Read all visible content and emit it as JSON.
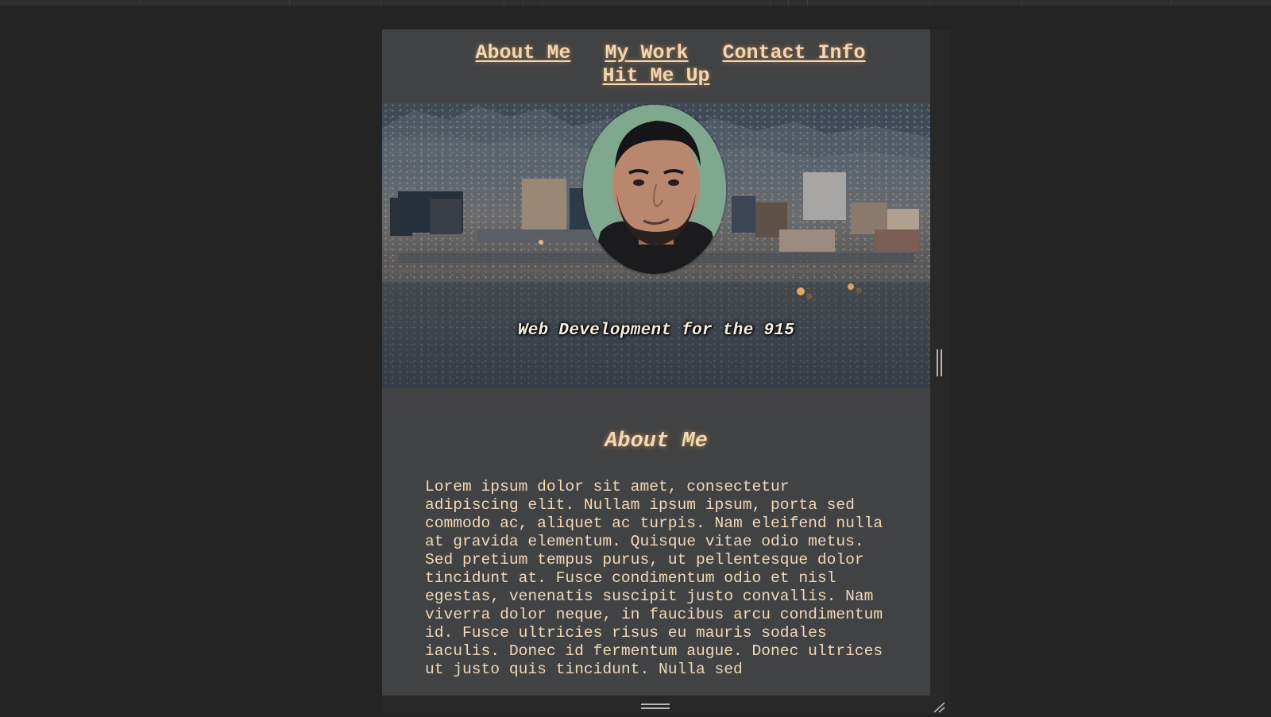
{
  "nav": {
    "items": [
      {
        "label": "About Me"
      },
      {
        "label": "My Work"
      },
      {
        "label": "Contact Info"
      },
      {
        "label": "Hit Me Up"
      }
    ]
  },
  "hero": {
    "tagline": "Web Development for the 915",
    "avatar_icon": "profile-photo"
  },
  "about": {
    "heading": "About Me",
    "body": "Lorem ipsum dolor sit amet, consectetur adipiscing elit. Nullam ipsum ipsum, porta sed commodo ac, aliquet ac turpis. Nam eleifend nulla at gravida elementum. Quisque vitae odio metus. Sed pretium tempus purus, ut pellentesque dolor tincidunt at. Fusce condimentum odio et nisl egestas, venenatis suscipit justo convallis. Nam viverra dolor neque, in faucibus arcu condimentum id. Fusce ultricies risus eu mauris sodales iaculis. Donec id fermentum augue. Donec ultrices ut justo quis tincidunt. Nulla sed"
  },
  "colors": {
    "page_background": "#242424",
    "viewport_background": "#414243",
    "accent_text": "#f3d7b3"
  }
}
